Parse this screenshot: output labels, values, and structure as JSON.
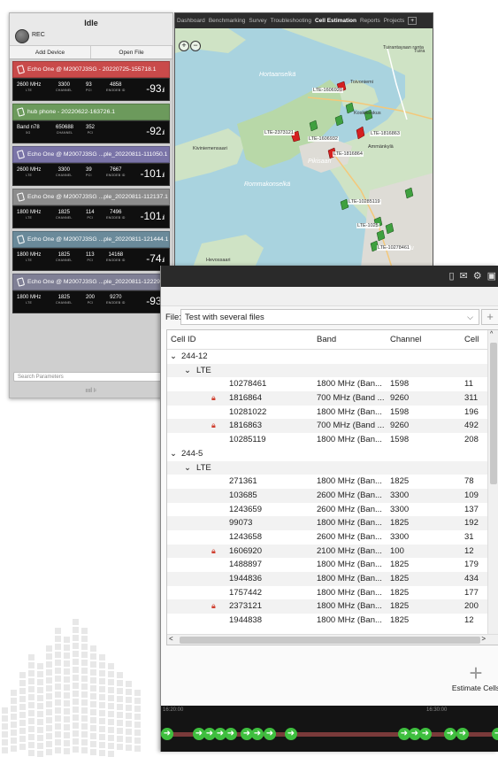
{
  "device_panel": {
    "status": "Idle",
    "rec_label": "REC",
    "add_device": "Add Device",
    "open_file": "Open File",
    "search_placeholder": "Search Parameters",
    "footer_icons": "ıııl  ⊧",
    "devices": [
      {
        "name": "Echo One @ M2007J3SG - 20220725-155718.1",
        "color": "#c94a4a",
        "band": "2600 MHz",
        "band_lab": "LTE",
        "channel": "3300",
        "channel_lab": "CHANNEL",
        "pci": "93",
        "pci_lab": "PCI",
        "cell": "4858",
        "cell_lab": "ENODEB ID",
        "rssi": "-93"
      },
      {
        "name": "hub phone - 20220622-163726.1",
        "color": "#6c9a5c",
        "band": "Band n78",
        "band_lab": "5G",
        "channel": "650688",
        "channel_lab": "CHANNEL",
        "pci": "352",
        "pci_lab": "PCI",
        "cell": "",
        "cell_lab": "",
        "rssi": "-92"
      },
      {
        "name": "Echo One @ M2007J3SG ...ple_20220811-111050.1",
        "color": "#7a74a8",
        "band": "2600 MHz",
        "band_lab": "LTE",
        "channel": "3300",
        "channel_lab": "CHANNEL",
        "pci": "39",
        "pci_lab": "PCI",
        "cell": "7667",
        "cell_lab": "ENODEB ID",
        "rssi": "-101"
      },
      {
        "name": "Echo One @ M2007J3SG ...ple_20220811-112137.1",
        "color": "#8c8c8c",
        "band": "1800 MHz",
        "band_lab": "LTE",
        "channel": "1825",
        "channel_lab": "CHANNEL",
        "pci": "114",
        "pci_lab": "PCI",
        "cell": "7496",
        "cell_lab": "ENODEB ID",
        "rssi": "-101"
      },
      {
        "name": "Echo One @ M2007J3SG ...ple_20220811-121444.1",
        "color": "#6a8a9a",
        "band": "1800 MHz",
        "band_lab": "LTE",
        "channel": "1825",
        "channel_lab": "CHANNEL",
        "pci": "113",
        "pci_lab": "PCI",
        "cell": "14168",
        "cell_lab": "ENODEB ID",
        "rssi": "-74"
      },
      {
        "name": "Echo One @ M2007J3SG ...ple_20220811-12229",
        "color": "#7f7f95",
        "band": "1800 MHz",
        "band_lab": "LTE",
        "channel": "1825",
        "channel_lab": "CHANNEL",
        "pci": "200",
        "pci_lab": "PCI",
        "cell": "9270",
        "cell_lab": "ENODEB ID",
        "rssi": "-93"
      }
    ]
  },
  "map": {
    "tabs": [
      "Dashboard",
      "Benchmarking",
      "Survey",
      "Troubleshooting",
      "Cell Estimation",
      "Reports",
      "Projects"
    ],
    "active_tab": "Cell Estimation",
    "add_tab": "+",
    "zoom_in": "+",
    "zoom_out": "−",
    "places": [
      "Hortaanselkä",
      "Tuirantayaan ranta",
      "Tuira",
      "Toivoniemi",
      "Koskikeskus",
      "Pikisaari",
      "Kiviniemensaari",
      "Ammänkylä",
      "Rommakonselkä",
      "Hevossaari",
      "Oulu"
    ],
    "markers": [
      "LTE-1606920",
      "LTE-2373121",
      "LTE-1816863",
      "LTE-1816864",
      "LTE-1606932",
      "LTE-10285119",
      "LTE-1025",
      "LTE-10278461"
    ]
  },
  "cell_estimation": {
    "file_label": "File:",
    "file_value": "Test with several files",
    "add_file": "+",
    "columns": [
      "Cell ID",
      "Band",
      "Channel",
      "Cell"
    ],
    "groups": [
      {
        "name": "244-12",
        "tech": "LTE",
        "rows": [
          {
            "id": "10278461",
            "band": "1800 MHz (Ban...",
            "channel": "1598",
            "cell": "11",
            "locked": false
          },
          {
            "id": "1816864",
            "band": "700 MHz (Band ...",
            "channel": "9260",
            "cell": "311",
            "locked": true
          },
          {
            "id": "10281022",
            "band": "1800 MHz (Ban...",
            "channel": "1598",
            "cell": "196",
            "locked": false
          },
          {
            "id": "1816863",
            "band": "700 MHz (Band ...",
            "channel": "9260",
            "cell": "492",
            "locked": true
          },
          {
            "id": "10285119",
            "band": "1800 MHz (Ban...",
            "channel": "1598",
            "cell": "208",
            "locked": false
          }
        ]
      },
      {
        "name": "244-5",
        "tech": "LTE",
        "rows": [
          {
            "id": "271361",
            "band": "1800 MHz (Ban...",
            "channel": "1825",
            "cell": "78",
            "locked": false
          },
          {
            "id": "103685",
            "band": "2600 MHz (Ban...",
            "channel": "3300",
            "cell": "109",
            "locked": false
          },
          {
            "id": "1243659",
            "band": "2600 MHz (Ban...",
            "channel": "3300",
            "cell": "137",
            "locked": false
          },
          {
            "id": "99073",
            "band": "1800 MHz (Ban...",
            "channel": "1825",
            "cell": "192",
            "locked": false
          },
          {
            "id": "1243658",
            "band": "2600 MHz (Ban...",
            "channel": "3300",
            "cell": "31",
            "locked": false
          },
          {
            "id": "1606920",
            "band": "2100 MHz (Ban...",
            "channel": "100",
            "cell": "12",
            "locked": true
          },
          {
            "id": "1488897",
            "band": "1800 MHz (Ban...",
            "channel": "1825",
            "cell": "179",
            "locked": false
          },
          {
            "id": "1944836",
            "band": "1800 MHz (Ban...",
            "channel": "1825",
            "cell": "434",
            "locked": false
          },
          {
            "id": "1757442",
            "band": "1800 MHz (Ban...",
            "channel": "1825",
            "cell": "177",
            "locked": false
          },
          {
            "id": "2373121",
            "band": "1800 MHz (Ban...",
            "channel": "1825",
            "cell": "200",
            "locked": true
          },
          {
            "id": "1944838",
            "band": "1800 MHz (Ban...",
            "channel": "1825",
            "cell": "12",
            "locked": false
          }
        ]
      }
    ],
    "estimate_label": "Estimate Cells",
    "timeline_ticks": [
      "16:20:00",
      "16:30:00"
    ]
  }
}
